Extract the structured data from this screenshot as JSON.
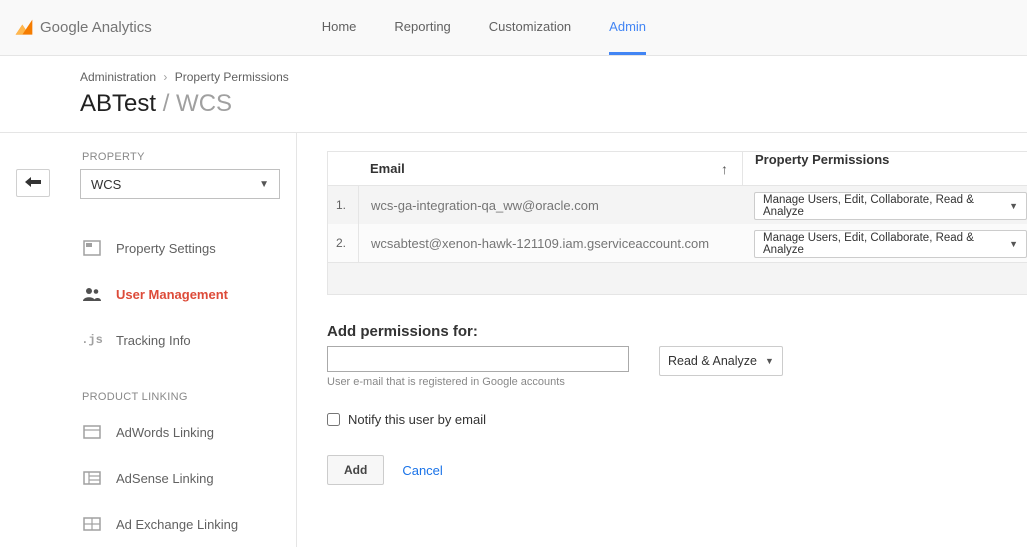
{
  "brand": "Google Analytics",
  "topnav": {
    "home": "Home",
    "reporting": "Reporting",
    "customization": "Customization",
    "admin": "Admin"
  },
  "breadcrumb": {
    "a": "Administration",
    "b": "Property Permissions"
  },
  "title": {
    "main": "ABTest",
    "sub": "WCS"
  },
  "sidebar": {
    "label_property": "PROPERTY",
    "selected_property": "WCS",
    "items": {
      "settings": "Property Settings",
      "user_mgmt": "User Management",
      "tracking": "Tracking Info"
    },
    "label_linking": "PRODUCT LINKING",
    "linking": {
      "adwords": "AdWords Linking",
      "adsense": "AdSense Linking",
      "adexchange": "Ad Exchange Linking"
    }
  },
  "table": {
    "col_email": "Email",
    "col_perm": "Property Permissions",
    "rows": [
      {
        "n": "1.",
        "email": "wcs-ga-integration-qa_ww@oracle.com",
        "perm": "Manage Users, Edit, Collaborate, Read & Analyze"
      },
      {
        "n": "2.",
        "email": "wcsabtest@xenon-hawk-121109.iam.gserviceaccount.com",
        "perm": "Manage Users, Edit, Collaborate, Read & Analyze"
      }
    ]
  },
  "add": {
    "heading": "Add permissions for:",
    "hint": "User e-mail that is registered in Google accounts",
    "default_perm": "Read & Analyze",
    "notify_label": "Notify this user by email",
    "add_btn": "Add",
    "cancel": "Cancel"
  }
}
